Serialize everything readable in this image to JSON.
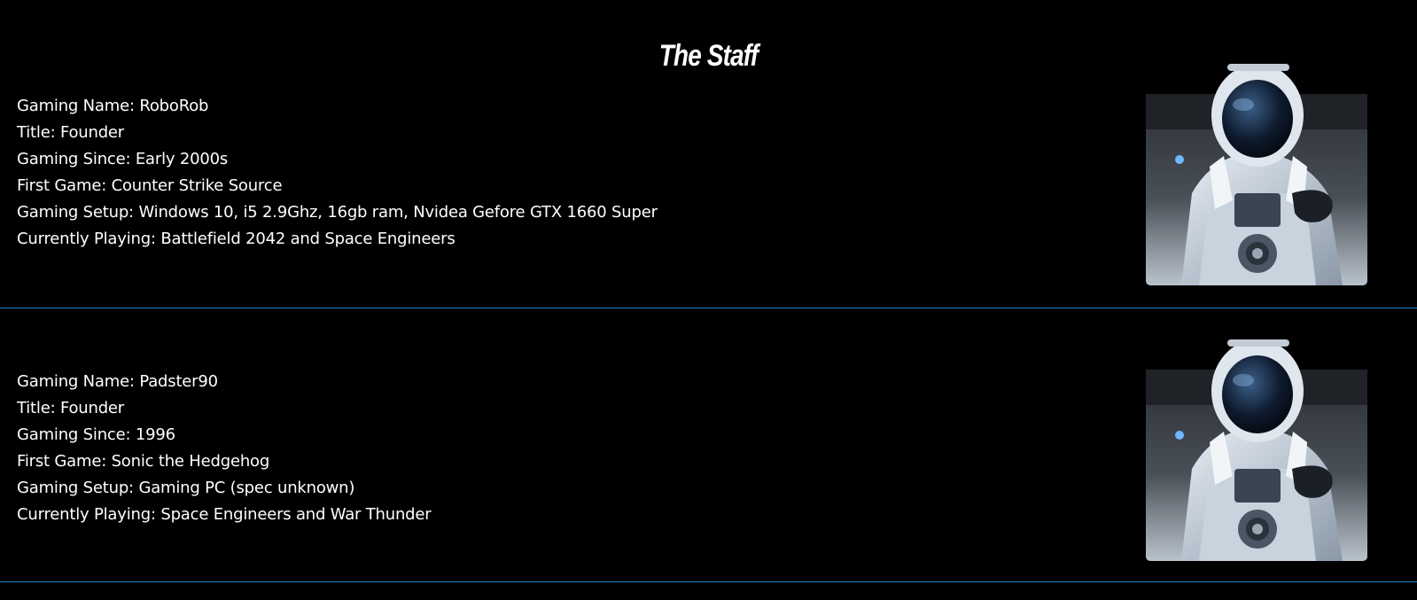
{
  "page": {
    "title": "The Staff"
  },
  "staff": [
    {
      "gaming_name": "Gaming Name: RoboRob",
      "title": "Title: Founder",
      "gaming_since": "Gaming Since: Early 2000s",
      "first_game": "First Game: Counter Strike Source",
      "gaming_setup": "Gaming Setup: Windows 10, i5 2.9Ghz, 16gb ram, Nvidea Gefore GTX 1660 Super",
      "currently_playing": "Currently Playing: Battlefield 2042 and Space Engineers",
      "avatar": "astronaut-avatar"
    },
    {
      "gaming_name": "Gaming Name: Padster90",
      "title": "Title: Founder",
      "gaming_since": "Gaming Since: 1996",
      "first_game": "First Game: Sonic the Hedgehog",
      "gaming_setup": "Gaming Setup: Gaming PC (spec unknown)",
      "currently_playing": "Currently Playing: Space Engineers and War Thunder",
      "avatar": "astronaut-avatar"
    }
  ],
  "colors": {
    "background": "#000000",
    "text": "#ffffff",
    "divider": "#1e88c8"
  }
}
